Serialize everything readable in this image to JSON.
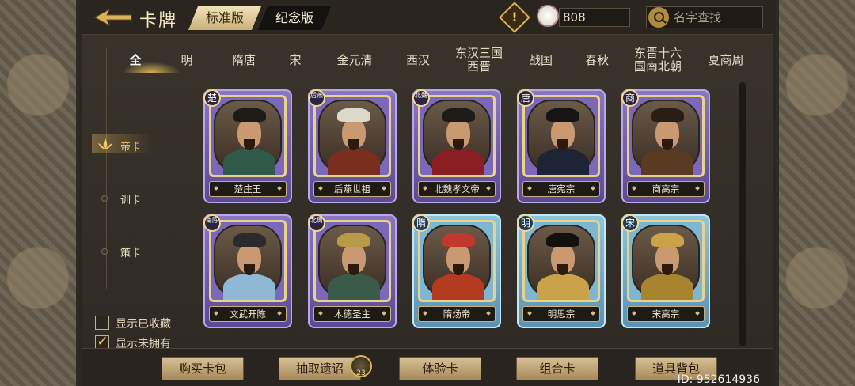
{
  "header": {
    "title": "卡牌",
    "version_tabs": [
      {
        "label": "标准版",
        "active": true
      },
      {
        "label": "纪念版",
        "active": false
      }
    ],
    "currency": {
      "icon": "crane-coin-icon",
      "value": "808"
    },
    "search": {
      "placeholder": "名字查找"
    }
  },
  "dynasty_tabs": [
    "全",
    "明",
    "隋唐",
    "宋",
    "金元清",
    "西汉",
    "东汉三国西晋",
    "战国",
    "春秋",
    "东晋十六国南北朝",
    "夏商周"
  ],
  "dynasty_tabs_display": [
    {
      "l1": "全",
      "l2": ""
    },
    {
      "l1": "明",
      "l2": ""
    },
    {
      "l1": "隋唐",
      "l2": ""
    },
    {
      "l1": "宋",
      "l2": ""
    },
    {
      "l1": "金元清",
      "l2": ""
    },
    {
      "l1": "西汉",
      "l2": ""
    },
    {
      "l1": "东汉三国",
      "l2": "西晋"
    },
    {
      "l1": "战国",
      "l2": ""
    },
    {
      "l1": "春秋",
      "l2": ""
    },
    {
      "l1": "东晋十六",
      "l2": "国南北朝"
    },
    {
      "l1": "夏商周",
      "l2": ""
    }
  ],
  "categories": [
    {
      "label": "帝卡",
      "active": true
    },
    {
      "label": "训卡",
      "active": false
    },
    {
      "label": "策卡",
      "active": false
    }
  ],
  "filters": [
    {
      "label": "显示已收藏",
      "checked": false
    },
    {
      "label": "显示未拥有",
      "checked": true
    }
  ],
  "cards": [
    {
      "name": "楚庄王",
      "badge": "楚",
      "rarity": "purple",
      "robe": "#2f5a4a",
      "hat": "#1e1a16"
    },
    {
      "name": "后燕世祖",
      "badge": "后燕",
      "rarity": "purple",
      "robe": "#7a2e1e",
      "hat": "#dcd8cc"
    },
    {
      "name": "北魏孝文帝",
      "badge": "北魏",
      "rarity": "purple",
      "robe": "#8a1e22",
      "hat": "#1e1a16"
    },
    {
      "name": "唐宪宗",
      "badge": "唐",
      "rarity": "purple",
      "robe": "#1e2436",
      "hat": "#161414"
    },
    {
      "name": "商高宗",
      "badge": "商",
      "rarity": "purple",
      "robe": "#5a3a22",
      "hat": "#2a1e14"
    },
    {
      "name": "文武开陈",
      "badge": "南陈",
      "rarity": "purple",
      "robe": "#8fb8d6",
      "hat": "#2a2a2a"
    },
    {
      "name": "木德圣主",
      "badge": "北周",
      "rarity": "purple",
      "robe": "#3a5a4a",
      "hat": "#b89a4a"
    },
    {
      "name": "隋炀帝",
      "badge": "隋",
      "rarity": "blue",
      "robe": "#b43a22",
      "hat": "#c0392b"
    },
    {
      "name": "明思宗",
      "badge": "明",
      "rarity": "blue",
      "robe": "#c9a24a",
      "hat": "#141010"
    },
    {
      "name": "宋高宗",
      "badge": "宋",
      "rarity": "blue",
      "robe": "#a88430",
      "hat": "#caa24a"
    }
  ],
  "bottom_buttons": [
    {
      "label": "购买卡包"
    },
    {
      "label": "抽取遗诏",
      "badge": "23"
    },
    {
      "label": "体验卡"
    },
    {
      "label": "组合卡"
    },
    {
      "label": "道具背包"
    }
  ],
  "user_id": "ID: 952614936"
}
